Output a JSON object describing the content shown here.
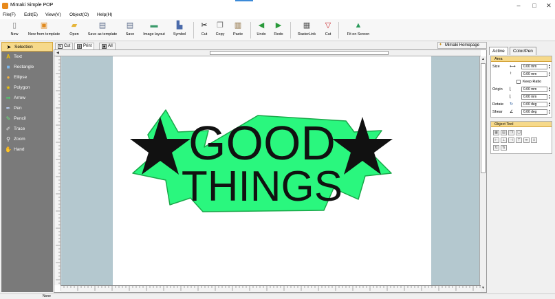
{
  "window": {
    "title": "Mimaki Simple POP",
    "minimize": "–",
    "maximize": "□",
    "close": "✕"
  },
  "menu": [
    "File(F)",
    "Edit(E)",
    "View(V)",
    "Object(O)",
    "Help(H)"
  ],
  "toolbar": {
    "new": "New",
    "new_from_template": "New from template",
    "open": "Open",
    "save_as_template": "Save as template",
    "save": "Save",
    "image_layout": "Image layout",
    "symbol": "Symbol",
    "cut": "Cut",
    "copy": "Copy",
    "paste": "Paste",
    "undo": "Undo",
    "redo": "Redo",
    "rasterlink": "RasterLink",
    "cut2": "Cut",
    "fit_on_screen": "Fit on Screen"
  },
  "tools": [
    "Selection",
    "Text",
    "Rectangle",
    "Ellipse",
    "Polygon",
    "Arrow",
    "Pen",
    "Pencil",
    "Trace",
    "Zoom",
    "Hand"
  ],
  "doc_tabs": [
    "Cut",
    "Print",
    "All"
  ],
  "homepage_link": "Mimaki Homepage",
  "artwork": {
    "line1": "GOOD",
    "line2": "THINGS",
    "fill": "#2af77e",
    "text_color": "#111111"
  },
  "props": {
    "tabs": [
      "Active",
      "Color/Pen"
    ],
    "area_title": "Area",
    "size_label": "Size",
    "width": "0.00 mm",
    "height": "0.00 mm",
    "keep_ratio": "Keep Ratio",
    "origin_label": "Origin",
    "origin_x": "0.00 mm",
    "origin_y": "0.00 mm",
    "rotate_label": "Rotate",
    "rotate": "0.00 deg",
    "shear_label": "Shear",
    "shear": "0.00 deg",
    "object_tool_title": "Object Tool"
  },
  "status": {
    "text": "None"
  }
}
